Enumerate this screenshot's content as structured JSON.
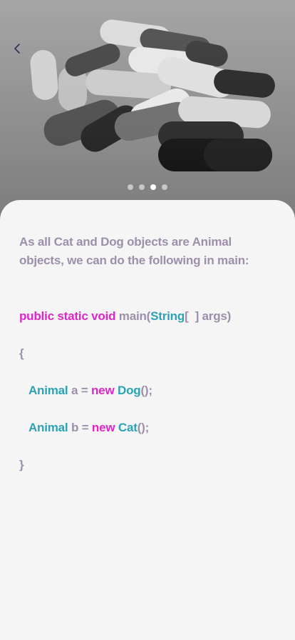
{
  "hero": {
    "image_alt": "Black and white capsules",
    "pager": {
      "count": 4,
      "active_index": 2
    }
  },
  "nav": {
    "back_icon": "chevron-left-icon"
  },
  "body": {
    "intro": "As all Cat and Dog objects are Animal objects, we can do the following in main:",
    "code": {
      "line1": {
        "kw": "public static void",
        "name": "main(",
        "type": "String",
        "rest": "[  ] args)"
      },
      "line2": "{",
      "line3": {
        "type1": "Animal",
        "var": " a = ",
        "kw": "new",
        "type2": "Dog",
        "end": "();"
      },
      "line4": {
        "type1": "Animal",
        "var": " b = ",
        "kw": "new",
        "type2": "Cat",
        "end": "();"
      },
      "line5": "}"
    }
  },
  "colors": {
    "keyword": "#e026c9",
    "type": "#2aa3b5",
    "plain": "#9d8fab",
    "background": "#f5f5f5"
  }
}
